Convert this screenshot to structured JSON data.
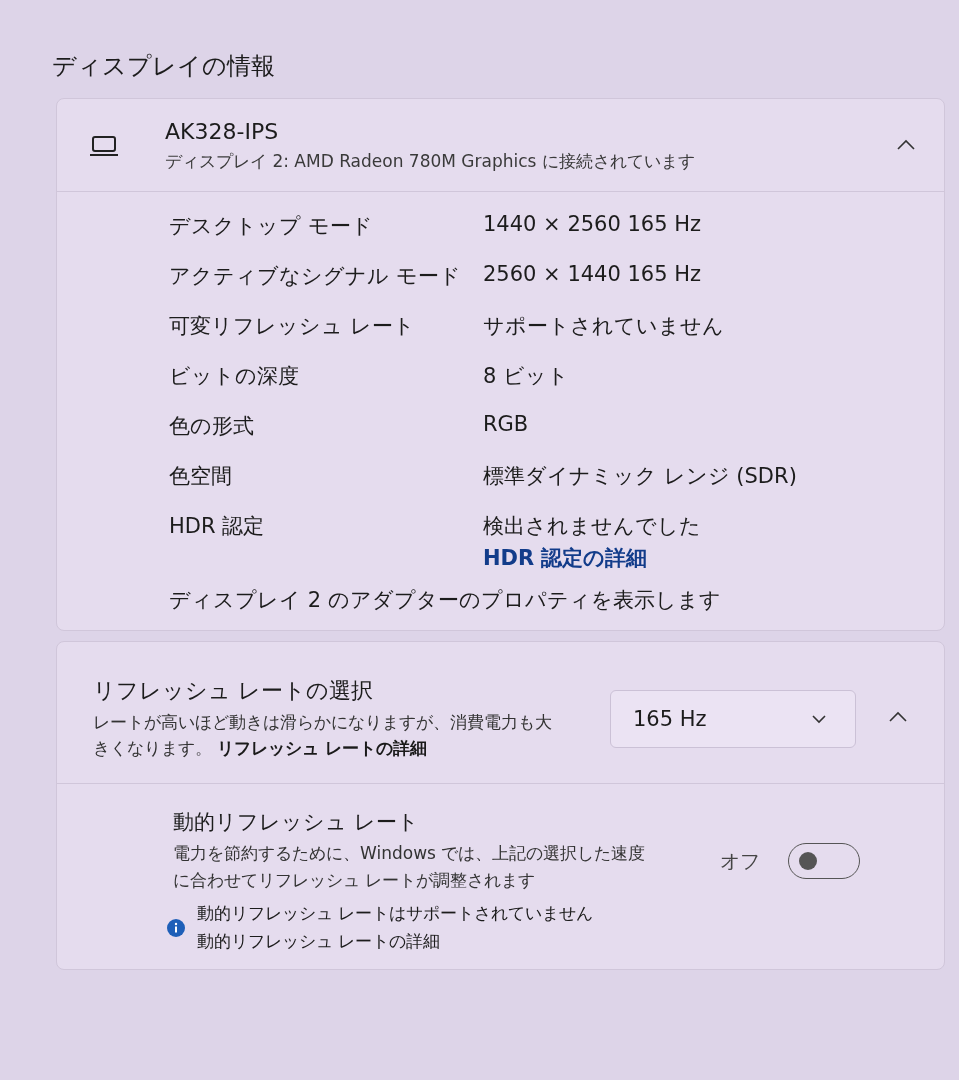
{
  "heading": "ディスプレイの情報",
  "display": {
    "name": "AK328-IPS",
    "subtitle": "ディスプレイ 2: AMD Radeon 780M Graphics に接続されています",
    "expanded": true,
    "rows": [
      {
        "label": "デスクトップ モード",
        "value": "1440 × 2560 165 Hz"
      },
      {
        "label": "アクティブなシグナル モード",
        "value": "2560 × 1440 165 Hz"
      },
      {
        "label": "可変リフレッシュ レート",
        "value": "サポートされていません"
      },
      {
        "label": "ビットの深度",
        "value": "8 ビット"
      },
      {
        "label": "色の形式",
        "value": "RGB"
      },
      {
        "label": "色空間",
        "value": "標準ダイナミック レンジ (SDR)"
      },
      {
        "label": "HDR 認定",
        "value": "検出されませんでした",
        "link": "HDR 認定の詳細"
      }
    ],
    "adapter_link": "ディスプレイ 2 のアダプターのプロパティを表示します"
  },
  "refresh": {
    "title": "リフレッシュ レートの選択",
    "description": "レートが高いほど動きは滑らかになりますが、消費電力も大きくなります。",
    "link": "リフレッシュ レートの詳細",
    "selected_rate": "165 Hz",
    "expanded": true,
    "dynamic": {
      "title": "動的リフレッシュ レート",
      "description": "電力を節約するために、Windows では、上記の選択した速度に合わせてリフレッシュ レートが調整されます",
      "state_label": "オフ",
      "on": false,
      "notice": "動的リフレッシュ レートはサポートされていません",
      "link": "動的リフレッシュ レートの詳細"
    }
  }
}
